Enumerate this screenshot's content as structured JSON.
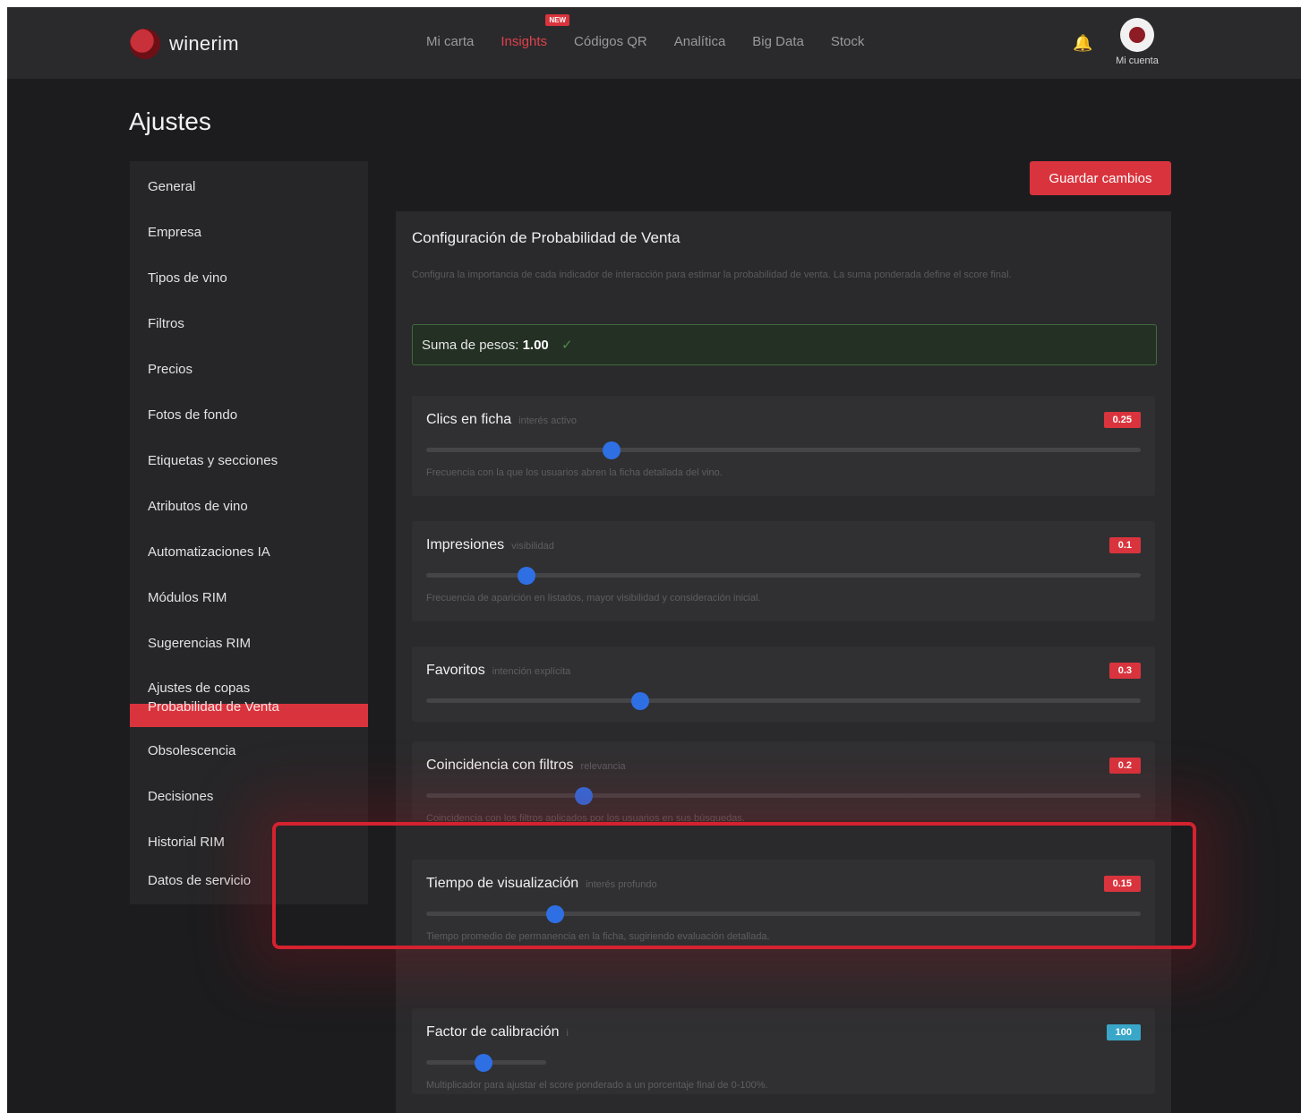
{
  "brand": {
    "name": "winerim"
  },
  "nav": {
    "items": [
      "Mi carta",
      "Insights",
      "Códigos QR",
      "Analítica",
      "Big Data",
      "Stock"
    ],
    "active_index": 1,
    "new_badge": "NEW"
  },
  "header": {
    "account_label": "Mi cuenta"
  },
  "page": {
    "title": "Ajustes"
  },
  "sidebar": {
    "items": [
      "General",
      "Empresa",
      "Tipos de vino",
      "Filtros",
      "Precios",
      "Fotos de fondo",
      "Etiquetas y secciones",
      "Atributos de vino",
      "Automatizaciones IA",
      "Módulos RIM",
      "Sugerencias RIM",
      "Ajustes de copas",
      "Obsolescencia",
      "Decisiones",
      "Historial RIM",
      "Datos de servicio"
    ],
    "active_label": "Probabilidad de Venta"
  },
  "toolbar": {
    "save_label": "Guardar cambios"
  },
  "panel": {
    "title": "Configuración de Probabilidad de Venta",
    "description": "Configura la importancia de cada indicador de interacción para estimar la probabilidad de venta. La suma ponderada define el score final.",
    "sum_label": "Suma de pesos:",
    "sum_value": "1.00",
    "sum_check": "✓"
  },
  "params": [
    {
      "name": "Clics en ficha",
      "hint": "interés activo",
      "value": "0.25",
      "level": 0.25,
      "description": "Frecuencia con la que los usuarios abren la ficha detallada del vino."
    },
    {
      "name": "Impresiones",
      "hint": "visibilidad",
      "value": "0.1",
      "level": 0.1,
      "description": "Frecuencia de aparición en listados, mayor visibilidad y consideración inicial."
    },
    {
      "name": "Favoritos",
      "hint": "intención explícita",
      "value": "0.3",
      "level": 0.3,
      "description": ""
    },
    {
      "name": "Coincidencia con filtros",
      "hint": "relevancia",
      "value": "0.2",
      "level": 0.2,
      "description": "Coincidencia con los filtros aplicados por los usuarios en sus búsquedas."
    },
    {
      "name": "Tiempo de visualización",
      "hint": "interés profundo",
      "value": "0.15",
      "level": 0.15,
      "description": "Tiempo promedio de permanencia en la ficha, sugiriendo evaluación detallada."
    },
    {
      "name": "Factor de calibración",
      "hint": "i",
      "value": "100",
      "level": 0.4,
      "description": "Multiplicador para ajustar el score ponderado a un porcentaje final de 0-100%."
    }
  ],
  "colors": {
    "accent": "#d9343d",
    "background": "#1c1c1e",
    "slider": "#2f6fe4",
    "highlight": "#d4222f"
  }
}
